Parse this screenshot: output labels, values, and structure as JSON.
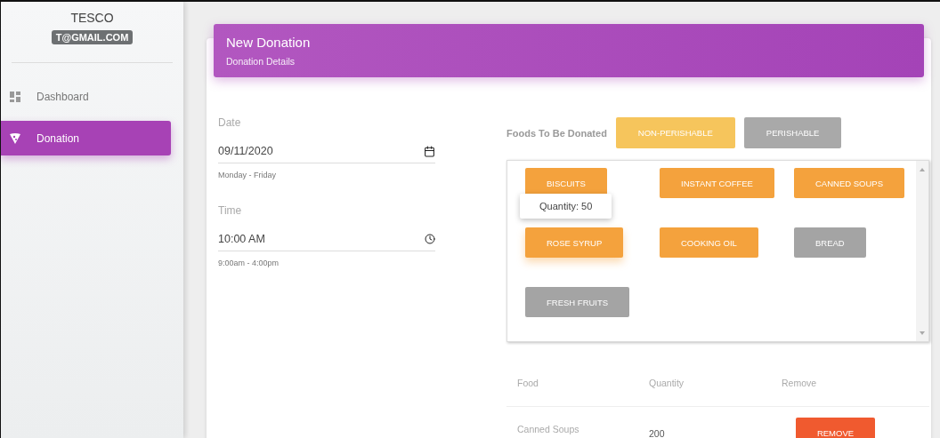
{
  "sidebar": {
    "title": "TESCO",
    "email": "T@GMAIL.COM",
    "items": [
      {
        "label": "Dashboard",
        "kind": "dashboard",
        "selected": false
      },
      {
        "label": "Donation",
        "kind": "donation",
        "selected": true
      }
    ]
  },
  "header": {
    "title": "New Donation",
    "subtitle": "Donation Details"
  },
  "form": {
    "date": {
      "label": "Date",
      "value": "09/11/2020",
      "hint": "Monday - Friday"
    },
    "time": {
      "label": "Time",
      "value": "10:00 AM",
      "hint": "9:00am - 4:00pm"
    }
  },
  "foods": {
    "label": "Foods To Be Donated",
    "categories": [
      {
        "label": "NON-PERISHABLE",
        "selected": true
      },
      {
        "label": "PERISHABLE",
        "selected": false
      }
    ],
    "items": [
      {
        "label": "BISCUITS",
        "selected": true
      },
      {
        "label": "INSTANT COFFEE",
        "selected": true
      },
      {
        "label": "CANNED SOUPS",
        "selected": true
      },
      {
        "label": "ROSE SYRUP",
        "selected": true,
        "tooltip": "Quantity: 50"
      },
      {
        "label": "COOKING OIL",
        "selected": true
      },
      {
        "label": "BREAD",
        "selected": false
      },
      {
        "label": "FRESH FRUITS",
        "selected": false
      }
    ]
  },
  "table": {
    "columns": [
      "Food",
      "Quantity",
      "Remove"
    ],
    "rows": [
      {
        "food": "Canned Soups",
        "quantity": "200",
        "action": "REMOVE"
      }
    ]
  }
}
